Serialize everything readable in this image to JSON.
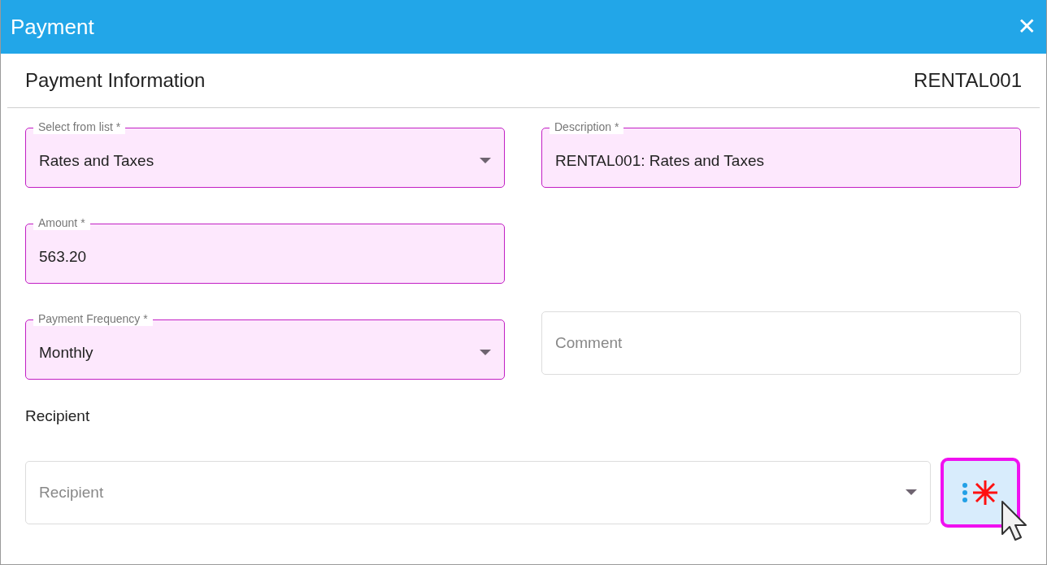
{
  "window": {
    "title": "Payment",
    "close": "✕"
  },
  "header": {
    "title": "Payment Information",
    "reference": "RENTAL001"
  },
  "rows": [
    [
      {
        "kind": "select",
        "label": "Select from list *",
        "value": "Rates and Taxes",
        "highlighted": true
      },
      {
        "kind": "text",
        "label": "Description *",
        "value": "RENTAL001: Rates and Taxes",
        "highlighted": true
      }
    ],
    [
      {
        "kind": "text",
        "label": "Amount *",
        "value": "563.20",
        "highlighted": true
      }
    ],
    [
      {
        "kind": "select",
        "label": "Payment Frequency *",
        "value": "Monthly",
        "highlighted": true
      },
      {
        "kind": "text",
        "placeholder": "Comment",
        "highlighted": false
      }
    ]
  ],
  "recipient": {
    "heading": "Recipient",
    "field": {
      "kind": "select",
      "placeholder": "Recipient",
      "highlighted": false
    },
    "more_button": {
      "highlighted": true
    }
  }
}
